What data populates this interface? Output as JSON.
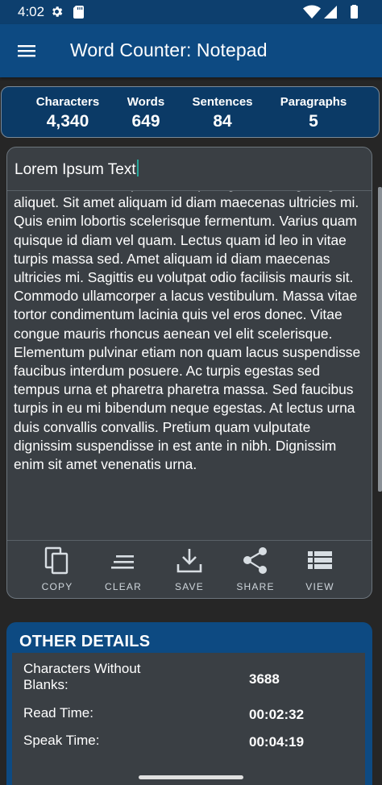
{
  "status_bar": {
    "time": "4:02",
    "icons": [
      "gear-icon",
      "sd-card-icon",
      "wifi-icon",
      "signal-icon",
      "battery-icon"
    ]
  },
  "app_bar": {
    "title": "Word Counter: Notepad",
    "menu_icon": "hamburger-menu-icon"
  },
  "stats": {
    "characters_label": "Characters",
    "characters_value": "4,340",
    "words_label": "Words",
    "words_value": "649",
    "sentences_label": "Sentences",
    "sentences_value": "84",
    "paragraphs_label": "Paragraphs",
    "paragraphs_value": "5"
  },
  "editor": {
    "title_value": "Lorem Ipsum Text",
    "body_text": "sit amet mauris vulputate. Turpis egestas integer eget aliquet. Sit amet aliquam id diam maecenas ultricies mi. Quis enim lobortis scelerisque fermentum. Varius quam quisque id diam vel quam. Lectus quam id leo in vitae turpis massa sed. Amet aliquam id diam maecenas ultricies mi. Sagittis eu volutpat odio facilisis mauris sit. Commodo ullamcorper a lacus vestibulum. Massa vitae tortor condimentum lacinia quis vel eros donec. Vitae congue mauris rhoncus aenean vel elit scelerisque. Elementum pulvinar etiam non quam lacus suspendisse faucibus interdum posuere. Ac turpis egestas sed tempus urna et pharetra pharetra massa. Sed faucibus turpis in eu mi bibendum neque egestas. At lectus urna duis convallis convallis. Pretium quam vulputate dignissim suspendisse in est ante in nibh. Dignissim enim sit amet venenatis urna."
  },
  "actions": {
    "copy": "COPY",
    "clear": "CLEAR",
    "save": "SAVE",
    "share": "SHARE",
    "view": "VIEW"
  },
  "details": {
    "title": "OTHER DETAILS",
    "chars_no_blanks_label": "Characters Without Blanks:",
    "chars_no_blanks_value": "3688",
    "read_time_label": "Read Time:",
    "read_time_value": "00:02:32",
    "speak_time_label": "Speak Time:",
    "speak_time_value": "00:04:19"
  },
  "colors": {
    "app_bar": "#0d4a82",
    "stats_card": "#0b3a66",
    "panel": "#3a3f44",
    "background": "#262626",
    "cursor_accent": "#26a69a"
  }
}
